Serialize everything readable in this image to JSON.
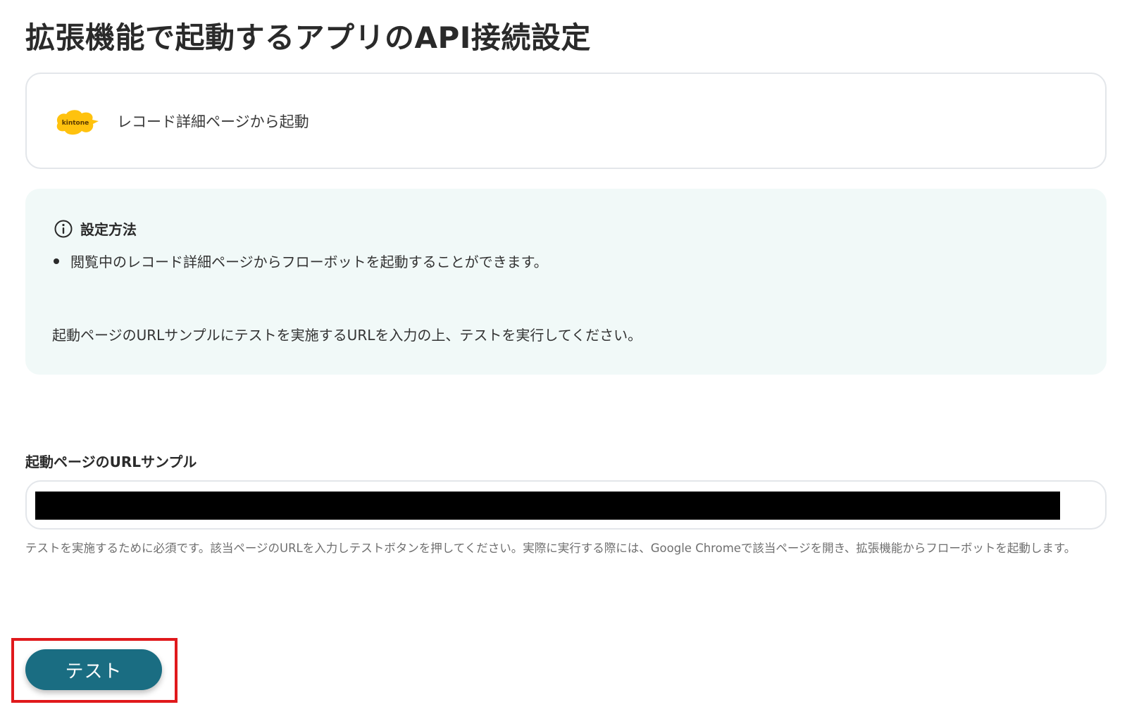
{
  "page": {
    "title": "拡張機能で起動するアプリのAPI接続設定"
  },
  "trigger": {
    "app_logo_text": "kintone",
    "label": "レコード詳細ページから起動"
  },
  "info": {
    "heading": "設定方法",
    "bullet": "閲覧中のレコード詳細ページからフローボットを起動することができます。",
    "note": "起動ページのURLサンプルにテストを実施するURLを入力の上、テストを実行してください。"
  },
  "url_field": {
    "label": "起動ページのURLサンプル",
    "value": "",
    "help": "テストを実施するために必須です。該当ページのURLを入力しテストボタンを押してください。実際に実行する際には、Google Chromeで該当ページを開き、拡張機能からフローボットを起動します。"
  },
  "actions": {
    "test_label": "テスト"
  },
  "colors": {
    "button": "#1a6d82",
    "info_background": "#f1f9f8",
    "highlight": "#e0191c",
    "logo": "#ffc20e"
  }
}
